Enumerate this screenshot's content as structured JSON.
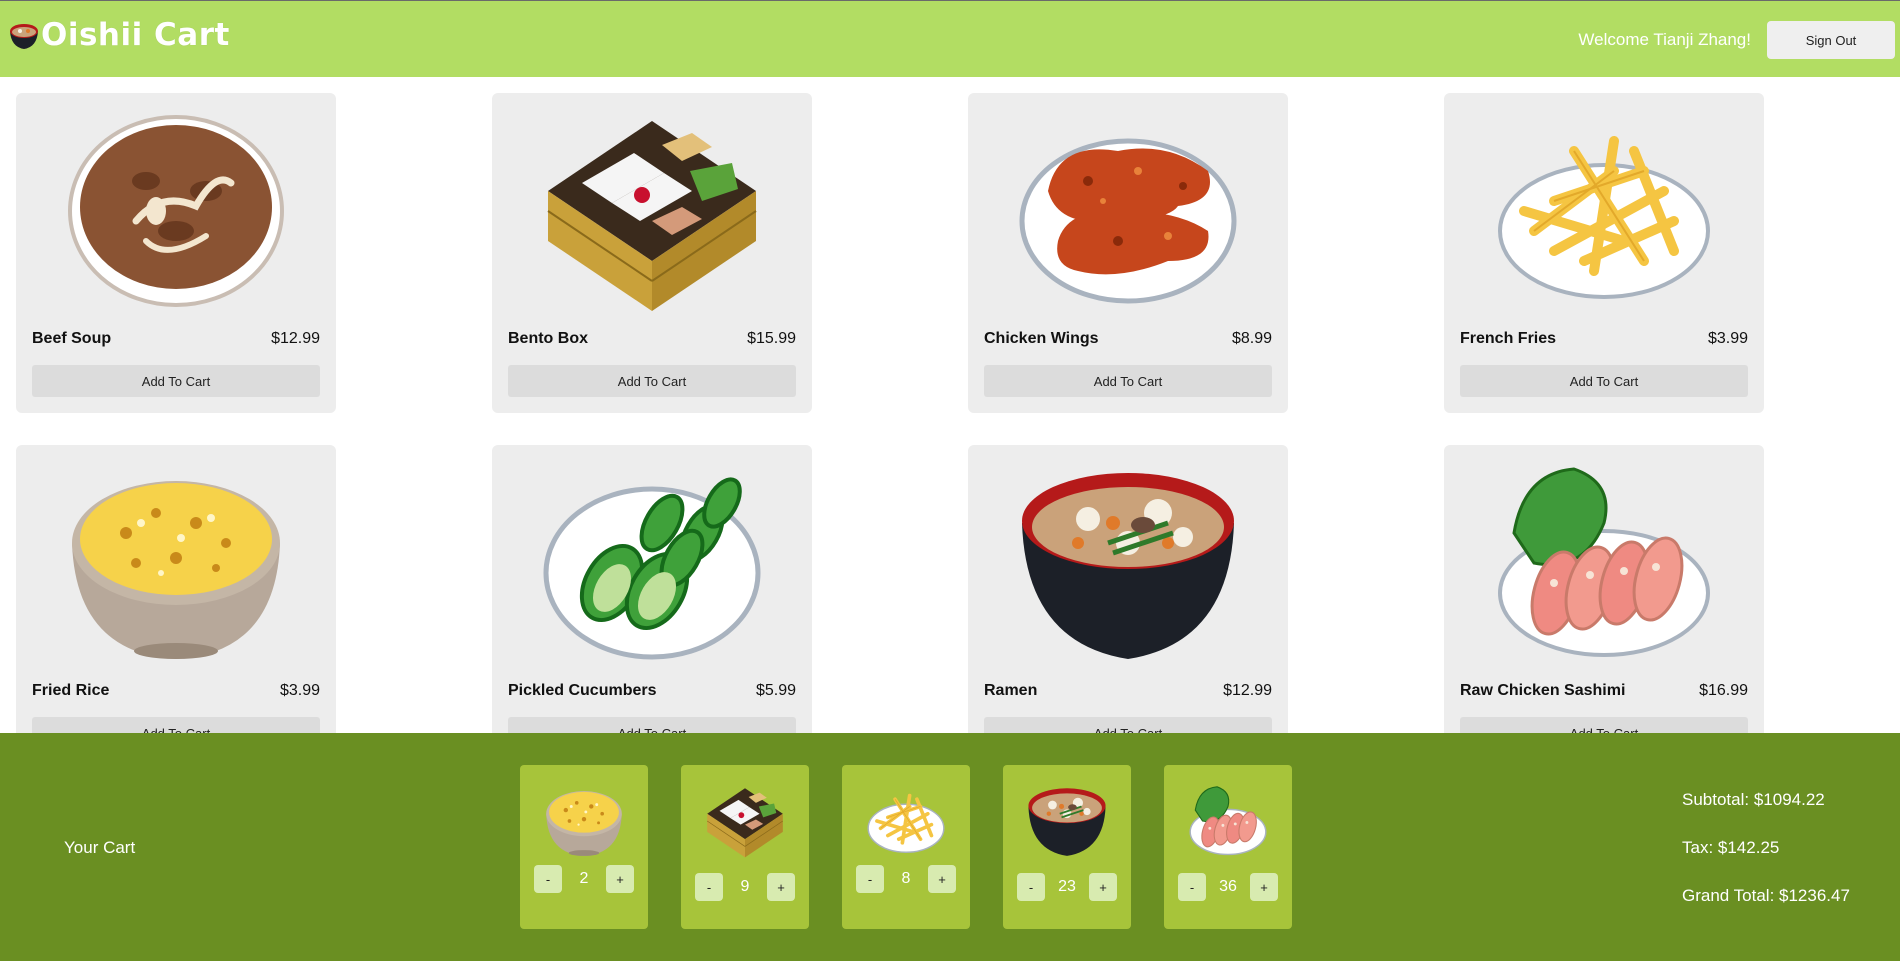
{
  "header": {
    "app_title": "Oishii Cart",
    "welcome_text": "Welcome Tianji Zhang!",
    "sign_out_label": "Sign Out"
  },
  "products": [
    {
      "name": "Beef Soup",
      "price": "$12.99",
      "button": "Add To Cart",
      "icon": "beef-soup-icon"
    },
    {
      "name": "Bento Box",
      "price": "$15.99",
      "button": "Add To Cart",
      "icon": "bento-box-icon"
    },
    {
      "name": "Chicken Wings",
      "price": "$8.99",
      "button": "Add To Cart",
      "icon": "chicken-wings-icon"
    },
    {
      "name": "French Fries",
      "price": "$3.99",
      "button": "Add To Cart",
      "icon": "french-fries-icon"
    },
    {
      "name": "Fried Rice",
      "price": "$3.99",
      "button": "Add To Cart",
      "icon": "fried-rice-icon"
    },
    {
      "name": "Pickled Cucumbers",
      "price": "$5.99",
      "button": "Add To Cart",
      "icon": "pickled-cucumbers-icon"
    },
    {
      "name": "Ramen",
      "price": "$12.99",
      "button": "Add To Cart",
      "icon": "ramen-icon"
    },
    {
      "name": "Raw Chicken Sashimi",
      "price": "$16.99",
      "button": "Add To Cart",
      "icon": "chicken-sashimi-icon"
    }
  ],
  "cart": {
    "title": "Your Cart",
    "items": [
      {
        "icon": "fried-rice-icon",
        "quantity": "2",
        "minus": "-",
        "plus": "+"
      },
      {
        "icon": "bento-box-icon",
        "quantity": "9",
        "minus": "-",
        "plus": "+"
      },
      {
        "icon": "french-fries-icon",
        "quantity": "8",
        "minus": "-",
        "plus": "+"
      },
      {
        "icon": "ramen-icon",
        "quantity": "23",
        "minus": "-",
        "plus": "+"
      },
      {
        "icon": "chicken-sashimi-icon",
        "quantity": "36",
        "minus": "-",
        "plus": "+"
      }
    ],
    "subtotal": "Subtotal: $1094.22",
    "tax": "Tax: $142.25",
    "grand_total": "Grand Total: $1236.47"
  },
  "colors": {
    "header_bg": "#b2dd63",
    "cart_bg": "#6a8f22",
    "cart_item_bg": "#a7c43a",
    "card_bg": "#ededed"
  }
}
